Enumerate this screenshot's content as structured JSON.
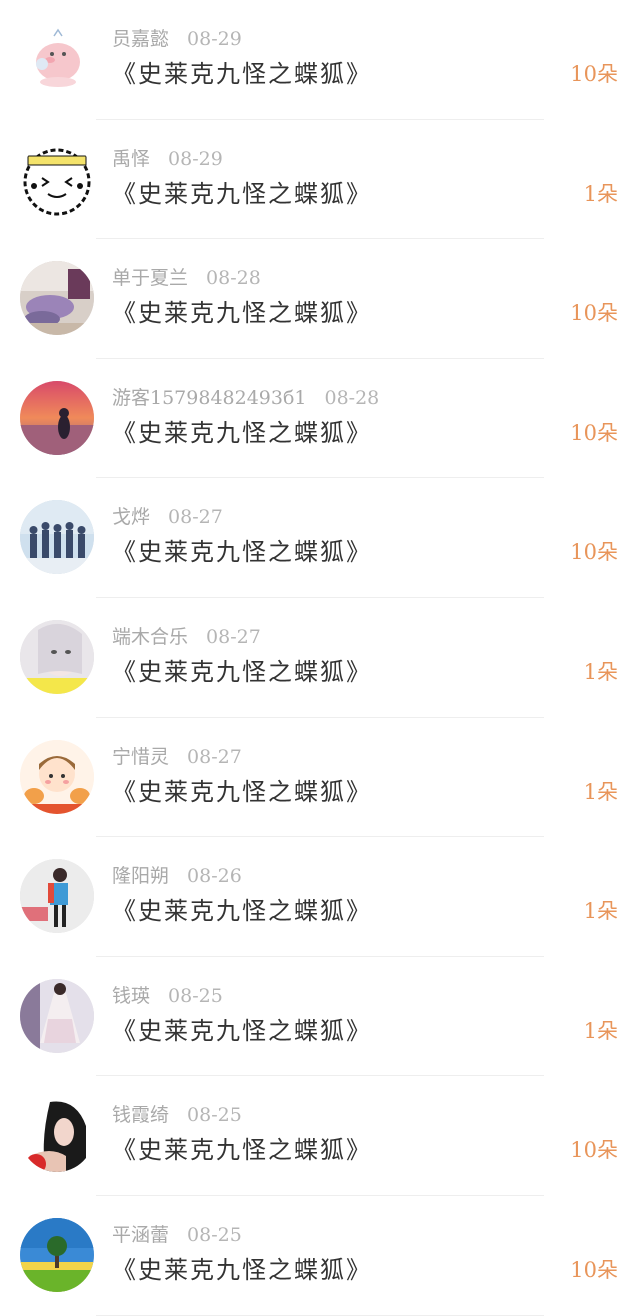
{
  "gifts": [
    {
      "user": "员嘉懿",
      "date": "08-29",
      "title": "《史莱克九怪之蝶狐》",
      "amount": "10朵",
      "avatar_icon": "pink-piglet-avatar"
    },
    {
      "user": "禹怿",
      "date": "08-29",
      "title": "《史莱克九怪之蝶狐》",
      "amount": "1朵",
      "avatar_icon": "cartoon-face-avatar"
    },
    {
      "user": "单于夏兰",
      "date": "08-28",
      "title": "《史莱克九怪之蝶狐》",
      "amount": "10朵",
      "avatar_icon": "photo-avatar"
    },
    {
      "user": "游客15798482493б1",
      "date": "08-28",
      "title": "《史莱克九怪之蝶狐》",
      "amount": "10朵",
      "avatar_icon": "sunset-avatar"
    },
    {
      "user": "戈烨",
      "date": "08-27",
      "title": "《史莱克九怪之蝶狐》",
      "amount": "10朵",
      "avatar_icon": "group-photo-avatar"
    },
    {
      "user": "端木合乐",
      "date": "08-27",
      "title": "《史莱克九怪之蝶狐》",
      "amount": "1朵",
      "avatar_icon": "girl-photo-avatar"
    },
    {
      "user": "宁惜灵",
      "date": "08-27",
      "title": "《史莱克九怪之蝶狐》",
      "amount": "1朵",
      "avatar_icon": "cartoon-girl-avatar"
    },
    {
      "user": "隆阳朔",
      "date": "08-26",
      "title": "《史莱克九怪之蝶狐》",
      "amount": "1朵",
      "avatar_icon": "person-photo-avatar"
    },
    {
      "user": "钱瑛",
      "date": "08-25",
      "title": "《史莱克九怪之蝶狐》",
      "amount": "1朵",
      "avatar_icon": "dress-photo-avatar"
    },
    {
      "user": "钱霞绮",
      "date": "08-25",
      "title": "《史莱克九怪之蝶狐》",
      "amount": "10朵",
      "avatar_icon": "woman-portrait-avatar"
    },
    {
      "user": "平涵蕾",
      "date": "08-25",
      "title": "《史莱克九怪之蝶狐》",
      "amount": "10朵",
      "avatar_icon": "tree-landscape-avatar"
    }
  ],
  "colors": {
    "username": "#a9a9a9",
    "title": "#333333",
    "amount": "#e8955a",
    "divider": "#eeeeee"
  }
}
